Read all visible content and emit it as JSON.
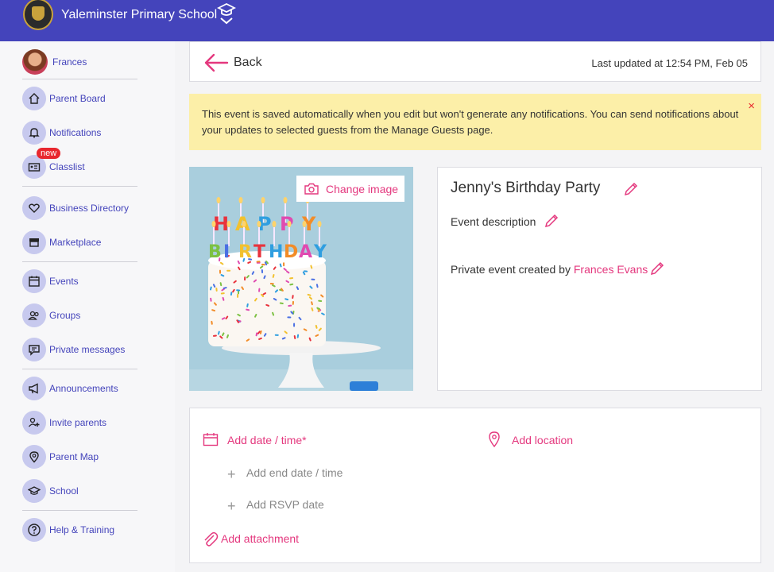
{
  "header": {
    "school_name": "Yaleminster Primary School"
  },
  "sidebar": {
    "user_name": "Frances",
    "items": [
      {
        "label": "Parent Board"
      },
      {
        "label": "Notifications"
      },
      {
        "label": "Classlist"
      },
      {
        "label": "Business Directory",
        "badge": "new"
      },
      {
        "label": "Marketplace"
      },
      {
        "label": "Events"
      },
      {
        "label": "Groups"
      },
      {
        "label": "Private messages"
      },
      {
        "label": "Announcements"
      },
      {
        "label": "Invite parents"
      },
      {
        "label": "Parent Map"
      },
      {
        "label": "School"
      },
      {
        "label": "Help & Training"
      }
    ]
  },
  "back_bar": {
    "back_label": "Back",
    "last_updated": "Last updated at 12:54 PM, Feb 05"
  },
  "notice": {
    "text": "This event is saved automatically when you edit but won't generate any notifications. You can send notifications about your updates to selected guests from the Manage Guests page.",
    "close": "×"
  },
  "image": {
    "change_label": "Change image",
    "candle_letters": [
      "H",
      "A",
      "P",
      "P",
      "Y",
      "B",
      "I",
      "R",
      "T",
      "H",
      "D",
      "A",
      "Y"
    ]
  },
  "event": {
    "title": "Jenny's Birthday Party",
    "description_placeholder": "Event description",
    "owner_prefix": "Private event created by ",
    "owner_name": "Frances Evans"
  },
  "details": {
    "add_date": "Add date / time*",
    "add_end_date": "Add end date / time",
    "add_rsvp": "Add RSVP date",
    "add_attachment": "Add attachment",
    "add_location": "Add location"
  },
  "colors": {
    "brand": "#4444bb",
    "accent": "#e4387e",
    "notice_bg": "#fcefa8"
  }
}
